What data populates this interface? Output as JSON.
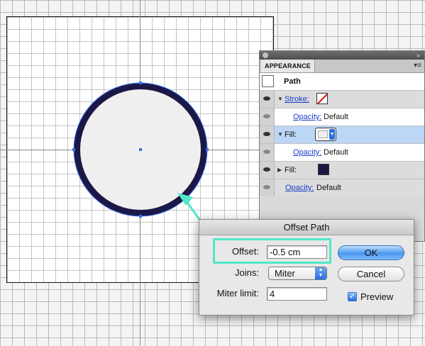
{
  "canvas": {
    "object": "circle",
    "stroke_color": "#1b1746",
    "fill_color": "#efefef",
    "anchor_color": "#3a6ee8",
    "callout_color": "#4fe8c8"
  },
  "appearance_panel": {
    "tab_label": "APPEARANCE",
    "menu_icon": "panel-menu-icon",
    "header_label": "Path",
    "rows": {
      "stroke_label": "Stroke:",
      "stroke_opacity_label": "Opacity:",
      "stroke_opacity_value": "Default",
      "fill1_label": "Fill:",
      "fill1_opacity_label": "Opacity:",
      "fill1_opacity_value": "Default",
      "fill2_label": "Fill:",
      "fill2_swatch_color": "#1b1746",
      "opacity_label": "Opacity:",
      "opacity_value": "Default"
    }
  },
  "dialog": {
    "title": "Offset Path",
    "offset_label": "Offset:",
    "offset_value": "-0.5 cm",
    "joins_label": "Joins:",
    "joins_value": "Miter",
    "miter_label": "Miter limit:",
    "miter_value": "4",
    "ok_label": "OK",
    "cancel_label": "Cancel",
    "preview_label": "Preview",
    "preview_checked": true
  }
}
